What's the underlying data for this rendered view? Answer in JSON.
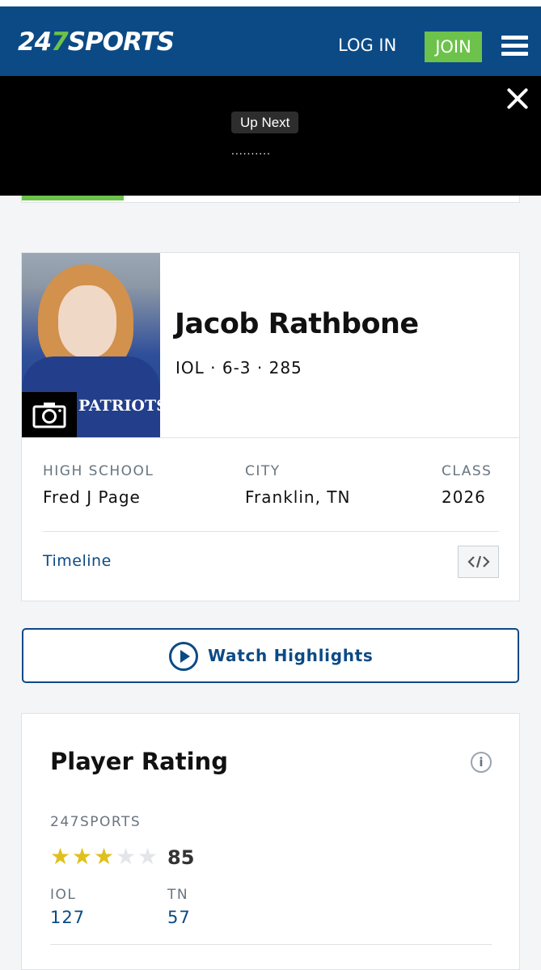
{
  "header": {
    "logo_num": "247",
    "logo_text": "SPORTS",
    "login_label": "LOG IN",
    "join_label": "JOIN",
    "accent_color": "#6cc24a",
    "brand_color": "#0b4a85"
  },
  "video": {
    "up_next_label": "Up Next",
    "loading_dots": ".........."
  },
  "player": {
    "name": "Jacob Rathbone",
    "meta": "IOL · 6-3 · 285",
    "photo_jersey_text": "PATRIOTS",
    "high_school_label": "HIGH SCHOOL",
    "high_school": "Fred J Page",
    "city_label": "CITY",
    "city": "Franklin, TN",
    "class_label": "CLASS",
    "class_year": "2026",
    "timeline_label": "Timeline"
  },
  "highlights": {
    "label": "Watch Highlights"
  },
  "rating": {
    "title": "Player Rating",
    "info_icon_text": "i",
    "source": "247SPORTS",
    "stars_filled": 3,
    "stars_total": 5,
    "score": "85",
    "position_label": "IOL",
    "position_rank": "127",
    "state_label": "TN",
    "state_rank": "57"
  }
}
